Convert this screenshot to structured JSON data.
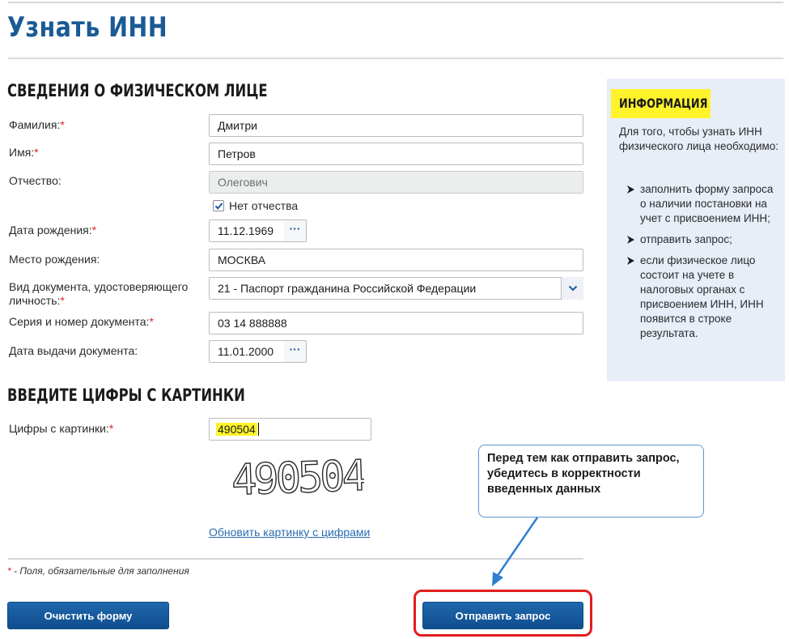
{
  "page_title": "Узнать ИНН",
  "person_section": {
    "heading": "СВЕДЕНИЯ О ФИЗИЧЕСКОМ ЛИЦЕ",
    "surname": {
      "label": "Фамилия:",
      "value": "Дмитри"
    },
    "name": {
      "label": "Имя:",
      "value": "Петров"
    },
    "patronymic": {
      "label": "Отчество:",
      "value": "Олегович"
    },
    "no_patronymic": {
      "label": "Нет отчества",
      "checked": true
    },
    "birth_date": {
      "label": "Дата рождения:",
      "value": "11.12.1969"
    },
    "birth_place": {
      "label": "Место рождения:",
      "value": "МОСКВА"
    },
    "doc_type": {
      "label_line1": "Вид документа, удостоверяющего",
      "label_line2": "личность:",
      "value": "21 - Паспорт гражданина Российской Федерации"
    },
    "doc_number": {
      "label": "Серия и номер документа:",
      "value": "03 14 888888"
    },
    "issue_date": {
      "label": "Дата выдачи документа:",
      "value": "11.01.2000"
    },
    "date_button": "···"
  },
  "captcha_section": {
    "heading": "ВВЕДИТЕ ЦИФРЫ С КАРТИНКИ",
    "label": "Цифры с картинки:",
    "value": "490504",
    "image_text": "490504",
    "refresh_link": "Обновить картинку с цифрами"
  },
  "required_mark": "*",
  "footnote": "- Поля, обязательные для заполнения",
  "buttons": {
    "clear": "Очистить форму",
    "submit": "Отправить запрос"
  },
  "info": {
    "title": "ИНФОРМАЦИЯ",
    "intro": "Для того, чтобы узнать ИНН физического лица необходимо:",
    "items": [
      "заполнить форму запроса о наличии постановки на учет с присвоением ИНН;",
      "отправить запрос;",
      "если физическое лицо состоит на учете в налоговых органах с присвоением ИНН, ИНН появится в строке результата."
    ]
  },
  "callout": "Перед тем как отправить запрос, убедитесь в корректности введенных данных",
  "colors": {
    "brand": "#1a5a95",
    "highlight": "#fff32b",
    "required": "#d9262b",
    "frame": "#e31d1d",
    "panel": "#e7eef8"
  }
}
